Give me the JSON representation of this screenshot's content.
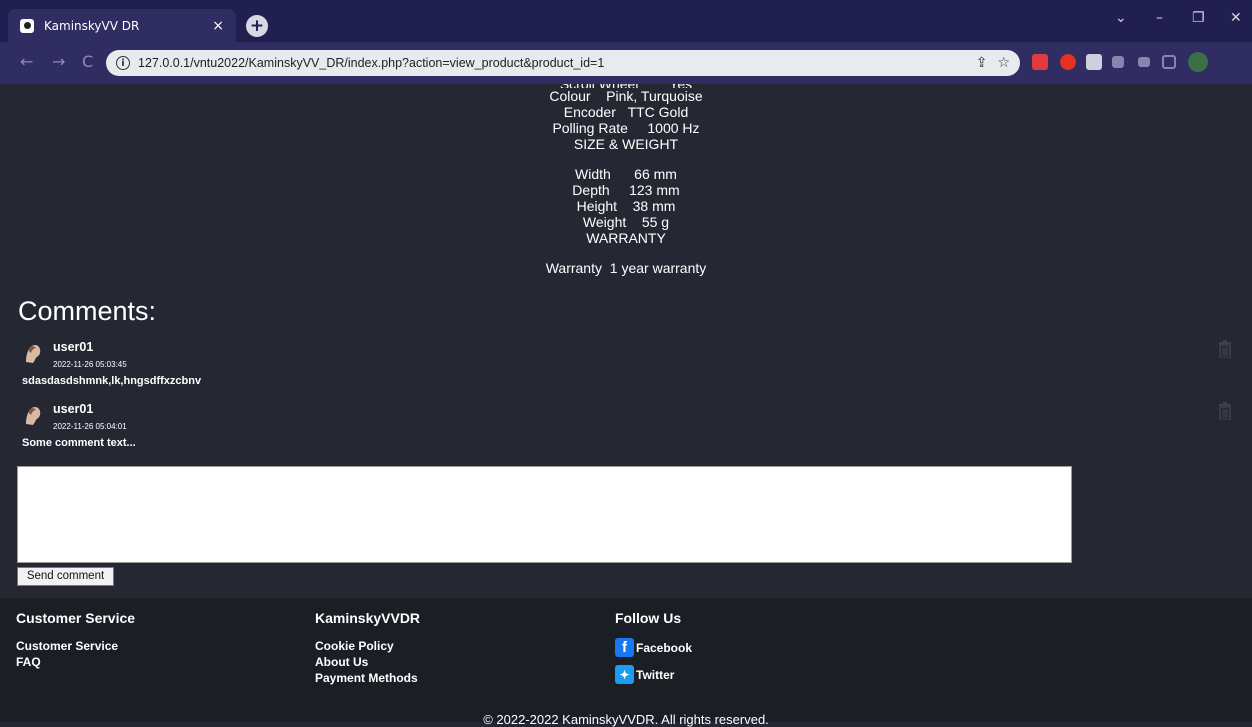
{
  "browser": {
    "tab_title": "KaminskyVV DR",
    "tab_close": "×",
    "new_tab": "+",
    "url": "127.0.0.1/vntu2022/KaminskyVV_DR/index.php?action=view_product&product_id=1",
    "window_controls": [
      "⌄",
      "–",
      "❐",
      "✕"
    ],
    "nav": [
      "←",
      "→",
      "C"
    ]
  },
  "specs": {
    "partial_row": "Scroll Wheel        Yes",
    "rows1": [
      {
        "label": "Colour",
        "value": "Pink, Turquoise"
      },
      {
        "label": "Encoder",
        "value": "TTC Gold"
      },
      {
        "label": "Polling Rate",
        "value": "1000 Hz"
      }
    ],
    "section2": "SIZE & WEIGHT",
    "rows2": [
      {
        "label": "Width",
        "value": "66 mm"
      },
      {
        "label": "Depth",
        "value": "123 mm"
      },
      {
        "label": "Height",
        "value": "38 mm"
      },
      {
        "label": "Weight",
        "value": "55 g"
      }
    ],
    "section3": "WARRANTY",
    "rows3": [
      {
        "label": "Warranty",
        "value": "1 year warranty"
      }
    ]
  },
  "comments": {
    "title": "Comments:",
    "items": [
      {
        "user": "user01",
        "date": "2022-11-26 05:03:45",
        "text": "sdasdasdshmnk,lk,hngsdffxzcbnv"
      },
      {
        "user": "user01",
        "date": "2022-11-26 05:04:01",
        "text": "Some comment text..."
      }
    ],
    "send_label": "Send comment"
  },
  "footer": {
    "col1": {
      "heading": "Customer Service",
      "links": [
        "Customer Service",
        "FAQ"
      ]
    },
    "col2": {
      "heading": "KaminskyVVDR",
      "links": [
        "Cookie Policy",
        "About Us",
        "Payment Methods"
      ]
    },
    "col3": {
      "heading": "Follow Us",
      "links": [
        "Facebook",
        "Twitter"
      ]
    },
    "copyright": "© 2022-2022 KaminskyVVDR. All rights reserved."
  },
  "colors": {
    "page_bg": "#252833",
    "footer_bg": "#1c1e26",
    "tabbar_bg": "#211f4f",
    "facebook": "#1877f2",
    "twitter": "#1d9bf0"
  }
}
